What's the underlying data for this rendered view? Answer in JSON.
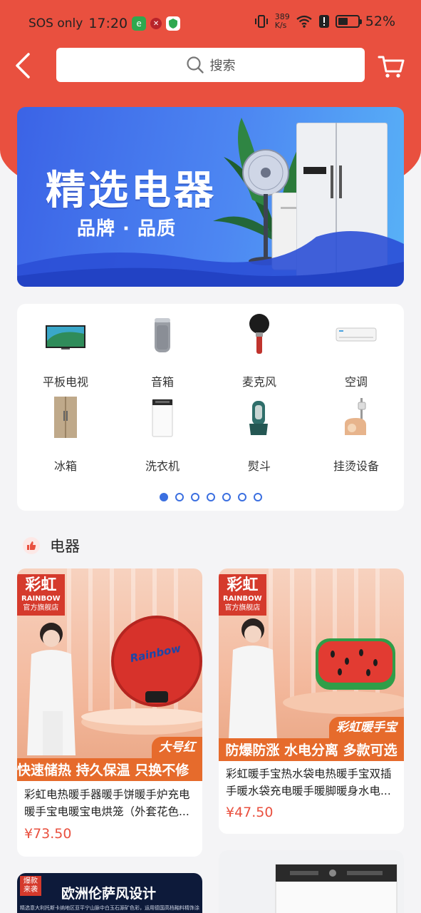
{
  "status_bar": {
    "carrier": "SOS only",
    "time": "17:20",
    "net_speed_value": "389",
    "net_speed_unit": "K/s",
    "battery_percent": "52%",
    "battery_level": 0.52
  },
  "top_bar": {
    "search_placeholder": "搜索"
  },
  "banner": {
    "title": "精选电器",
    "subtitle": "品牌 · 品质"
  },
  "categories": [
    {
      "label": "平板电视",
      "icon": "tv-icon"
    },
    {
      "label": "音箱",
      "icon": "speaker-icon"
    },
    {
      "label": "麦克风",
      "icon": "microphone-icon"
    },
    {
      "label": "空调",
      "icon": "air-conditioner-icon"
    },
    {
      "label": "冰箱",
      "icon": "fridge-icon"
    },
    {
      "label": "洗衣机",
      "icon": "washing-machine-icon"
    },
    {
      "label": "熨斗",
      "icon": "iron-icon"
    },
    {
      "label": "挂烫设备",
      "icon": "garment-steamer-icon"
    }
  ],
  "pagination": {
    "count": 7,
    "active_index": 0
  },
  "section": {
    "title": "电器"
  },
  "products": [
    {
      "brand_cn": "彩虹",
      "brand_en": "RAINBOW",
      "brand_store": "官方旗舰店",
      "product_logo_text": "Rainbow",
      "promo_strip": "快速储热 持久保温 只换不修",
      "promo_tag": "大号红",
      "name": "彩虹电热暖手器暖手饼暖手炉充电暖手宝电暖宝电烘笼（外套花色...",
      "price": "¥73.50"
    },
    {
      "brand_cn": "彩虹",
      "brand_en": "RAINBOW",
      "brand_store": "官方旗舰店",
      "promo_strip": "防爆防涨 水电分离 多款可选",
      "promo_tag": "彩虹暖手宝",
      "name": "彩虹暖手宝热水袋电热暖手宝双插手暖水袋充电暖手暖脚暖身水电...",
      "price": "¥47.50"
    },
    {
      "badge": "爆款\n来袭",
      "headline": "欧洲伦萨风设计",
      "fineprint": "精选意大利托斯卡纳地区亚平宁山脉中白玉石源矿色彩，运用德国高档釉料精饰涂装"
    }
  ],
  "colors": {
    "header_red": "#e9503f",
    "price_red": "#e9503f",
    "accent_blue": "#3b6fe0"
  }
}
